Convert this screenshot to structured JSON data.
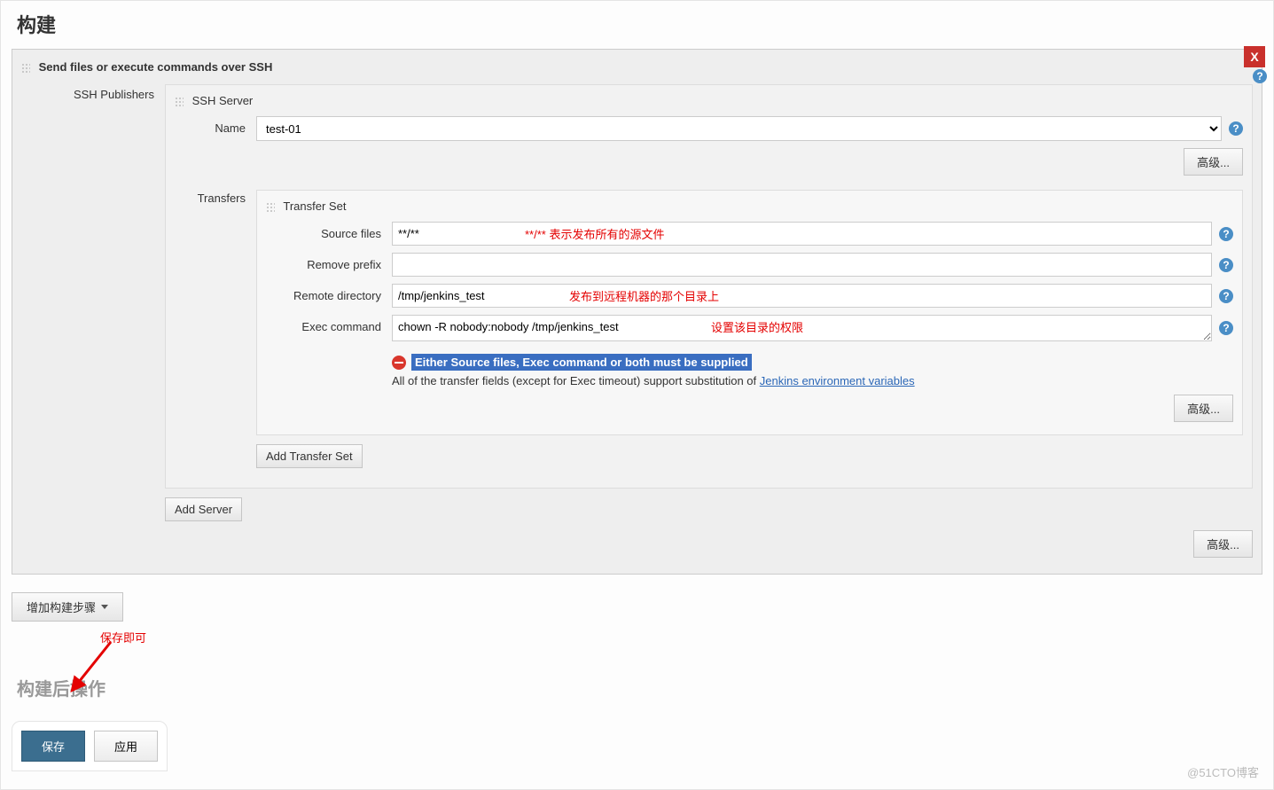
{
  "section": {
    "title": "构建"
  },
  "step": {
    "title": "Send files or execute commands over SSH",
    "close_label": "X",
    "ssh_publishers_label": "SSH Publishers",
    "ssh_server": {
      "section_label": "SSH Server",
      "name_label": "Name",
      "name_value": "test-01",
      "advanced_label": "高级..."
    },
    "transfers": {
      "label": "Transfers",
      "set_label": "Transfer Set",
      "source_files_label": "Source files",
      "source_files_value": "**/**",
      "source_files_annotation": "**/** 表示发布所有的源文件",
      "remove_prefix_label": "Remove prefix",
      "remove_prefix_value": "",
      "remote_dir_label": "Remote directory",
      "remote_dir_value": "/tmp/jenkins_test",
      "remote_dir_annotation": "发布到远程机器的那个目录上",
      "exec_cmd_label": "Exec command",
      "exec_cmd_value": "chown -R nobody:nobody /tmp/jenkins_test",
      "exec_cmd_annotation": "设置该目录的权限",
      "error_text": "Either Source files, Exec command or both must be supplied",
      "hint_prefix": "All of the transfer fields (except for Exec timeout) support substitution of ",
      "hint_link": "Jenkins environment variables",
      "advanced_label": "高级...",
      "add_set_label": "Add Transfer Set"
    },
    "add_server_label": "Add Server",
    "outer_advanced_label": "高级..."
  },
  "add_build_step_label": "增加构建步骤",
  "save_annotation": "保存即可",
  "post_build_title": "构建后操作",
  "footer": {
    "save_label": "保存",
    "apply_label": "应用"
  },
  "watermark": "@51CTO博客"
}
